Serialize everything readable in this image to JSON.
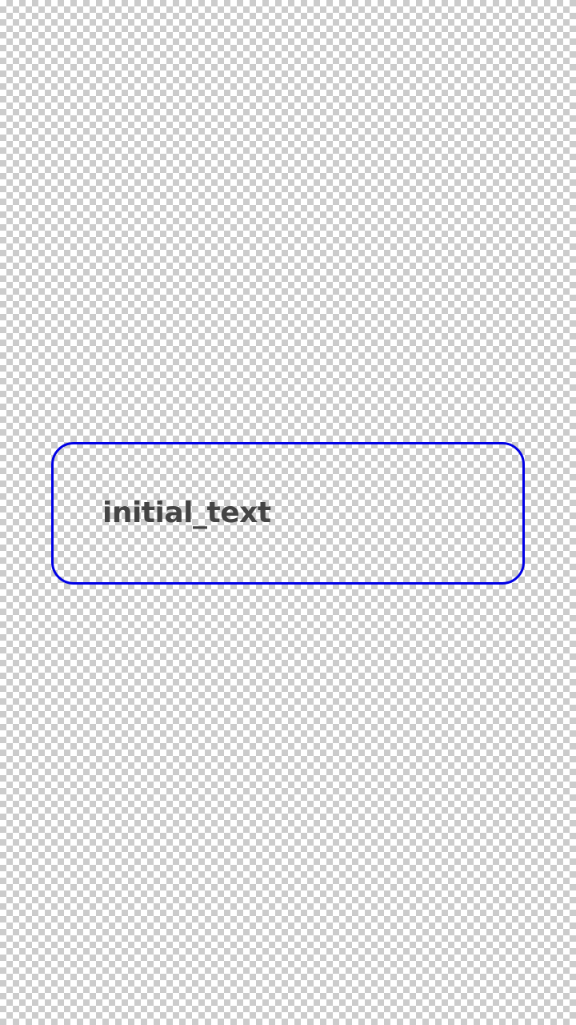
{
  "text_field": {
    "value": "initial_text",
    "border_color": "#0000e6",
    "text_color": "#444444"
  }
}
